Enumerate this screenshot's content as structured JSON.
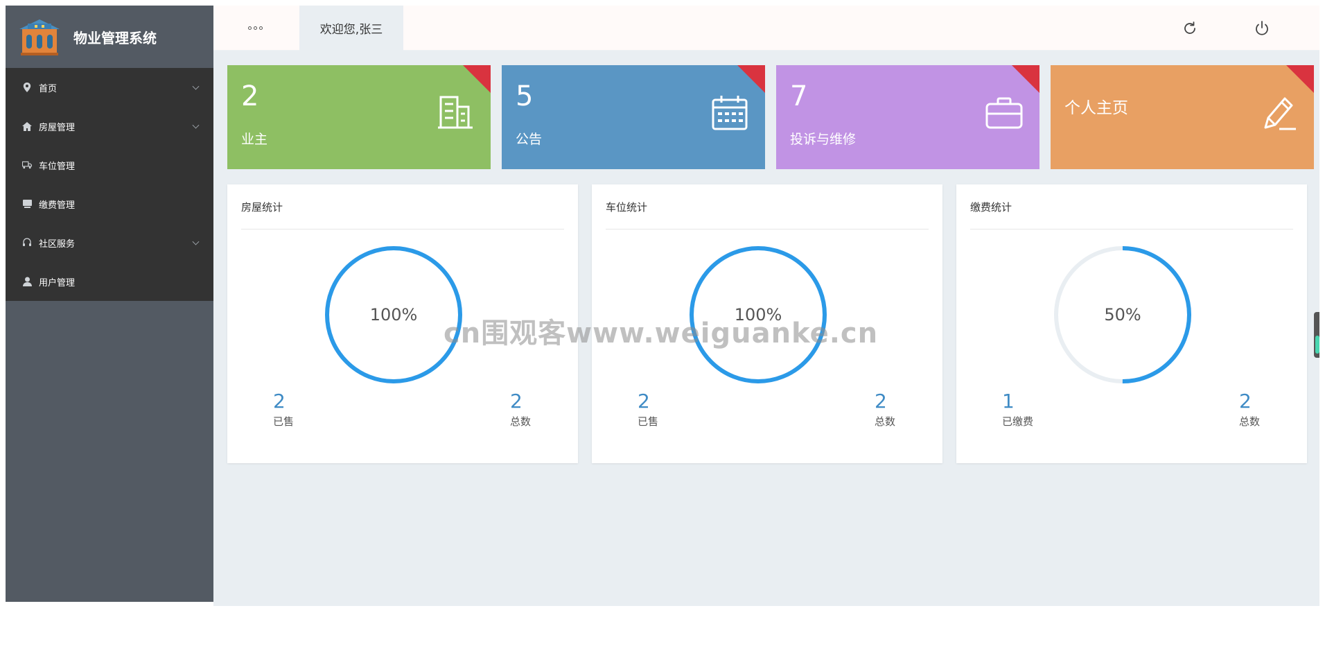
{
  "app": {
    "title": "物业管理系统"
  },
  "sidebar": {
    "items": [
      {
        "label": "首页",
        "icon": "location-pin-icon",
        "has_children": true
      },
      {
        "label": "房屋管理",
        "icon": "home-icon",
        "has_children": true
      },
      {
        "label": "车位管理",
        "icon": "truck-icon",
        "has_children": false
      },
      {
        "label": "缴费管理",
        "icon": "card-icon",
        "has_children": false
      },
      {
        "label": "社区服务",
        "icon": "headset-icon",
        "has_children": true
      },
      {
        "label": "用户管理",
        "icon": "user-icon",
        "has_children": false
      }
    ]
  },
  "header": {
    "menu_icon": "more-dots-icon",
    "tab_label": "欢迎您,张三",
    "refresh_icon": "refresh-icon",
    "power_icon": "power-icon"
  },
  "cards": [
    {
      "value": "2",
      "label": "业主",
      "color": "#8ebf63",
      "icon": "building-icon"
    },
    {
      "value": "5",
      "label": "公告",
      "color": "#5a96c4",
      "icon": "calendar-icon"
    },
    {
      "value": "7",
      "label": "投诉与维修",
      "color": "#c193e4",
      "icon": "briefcase-icon"
    },
    {
      "value": "",
      "label": "个人主页",
      "color": "#e8a063",
      "icon": "pencil-icon"
    }
  ],
  "panels": [
    {
      "title": "房屋统计",
      "percent": "100%",
      "progress": 1.0,
      "left_value": "2",
      "left_label": "已售",
      "right_value": "2",
      "right_label": "总数"
    },
    {
      "title": "车位统计",
      "percent": "100%",
      "progress": 1.0,
      "left_value": "2",
      "left_label": "已售",
      "right_value": "2",
      "right_label": "总数"
    },
    {
      "title": "缴费统计",
      "percent": "50%",
      "progress": 0.5,
      "left_value": "1",
      "left_label": "已缴费",
      "right_value": "2",
      "right_label": "总数"
    }
  ],
  "watermark": "cn围观客www.weiguanke.cn",
  "colors": {
    "sidebar": "#535a63",
    "menu": "#333333",
    "ring": "#2b9ae8",
    "ring_track": "#e9eef2",
    "corner": "#d9333f"
  }
}
